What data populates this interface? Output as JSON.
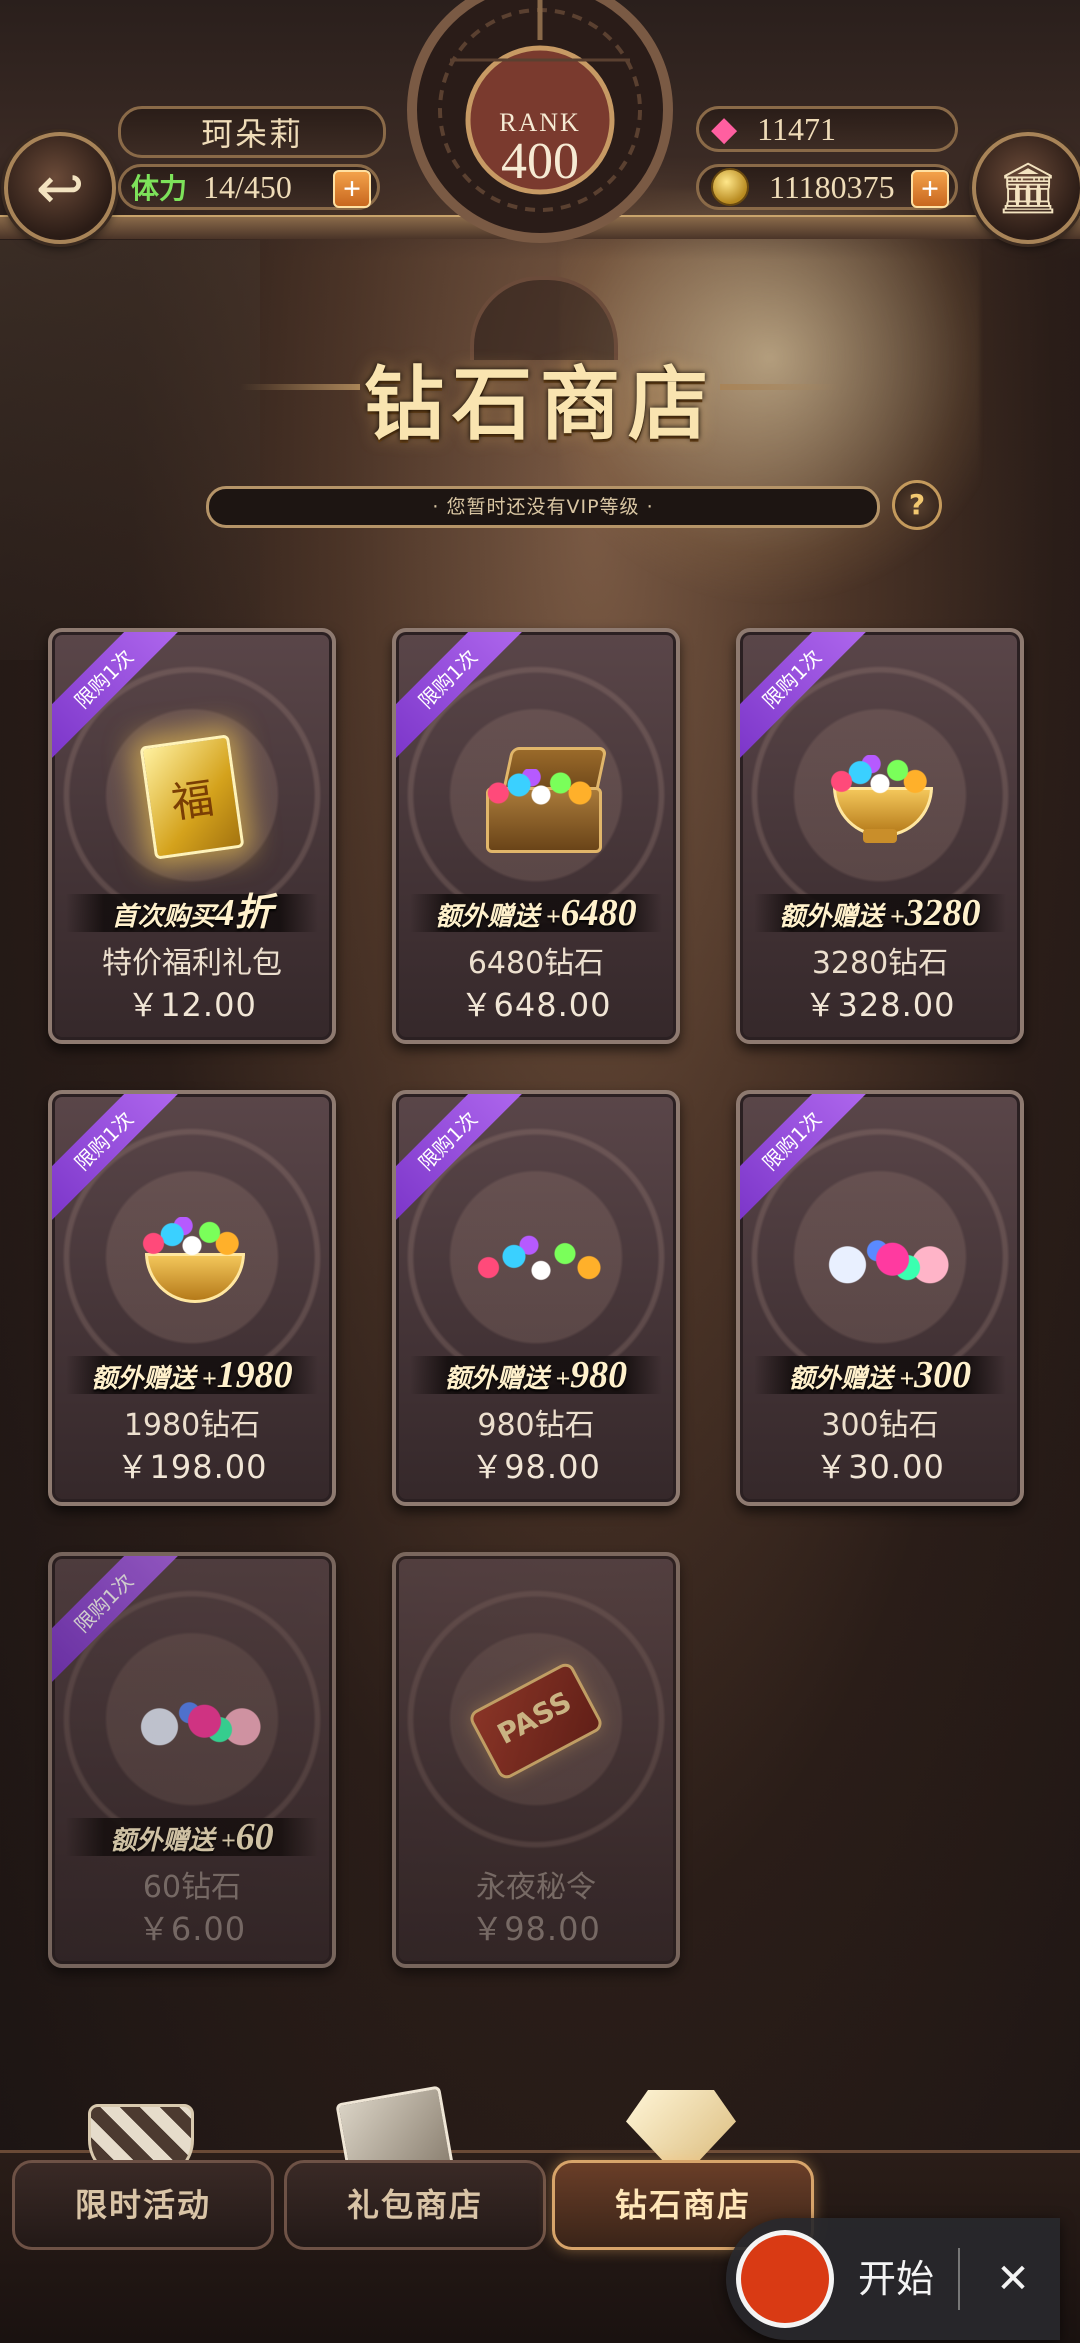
{
  "header": {
    "player_name": "珂朵莉",
    "stamina_label": "体力",
    "stamina_value": "14/450",
    "rank_label": "RANK",
    "rank_value": "400",
    "diamonds": "11471",
    "gold": "11180375",
    "plus_symbol": "+"
  },
  "shop": {
    "title": "钻石商店",
    "vip_notice": "· 您暂时还没有VIP等级 ·",
    "help_symbol": "?"
  },
  "cards": [
    {
      "badge": "限购1次",
      "bonus_prefix": "首次购买",
      "bonus_value": "4折",
      "name": "特价福利礼包",
      "price": "￥12.00",
      "icon": "fu-card-icon",
      "dim": false
    },
    {
      "badge": "限购1次",
      "bonus_prefix": "额外赠送 +",
      "bonus_value": "6480",
      "name": "6480钻石",
      "price": "￥648.00",
      "icon": "treasure-chest-icon",
      "dim": false
    },
    {
      "badge": "限购1次",
      "bonus_prefix": "额外赠送 +",
      "bonus_value": "3280",
      "name": "3280钻石",
      "price": "￥328.00",
      "icon": "gem-bowl-icon",
      "dim": false
    },
    {
      "badge": "限购1次",
      "bonus_prefix": "额外赠送 +",
      "bonus_value": "1980",
      "name": "1980钻石",
      "price": "￥198.00",
      "icon": "gem-bowl-icon",
      "dim": false
    },
    {
      "badge": "限购1次",
      "bonus_prefix": "额外赠送 +",
      "bonus_value": "980",
      "name": "980钻石",
      "price": "￥98.00",
      "icon": "gem-pile-icon",
      "dim": false
    },
    {
      "badge": "限购1次",
      "bonus_prefix": "额外赠送 +",
      "bonus_value": "300",
      "name": "300钻石",
      "price": "￥30.00",
      "icon": "gem-small-pile-icon",
      "dim": false
    },
    {
      "badge": "限购1次",
      "bonus_prefix": "额外赠送 +",
      "bonus_value": "60",
      "name": "60钻石",
      "price": "￥6.00",
      "icon": "gem-small-pile-icon",
      "dim": true
    },
    {
      "badge": "",
      "bonus_prefix": "",
      "bonus_value": "",
      "name": "永夜秘令",
      "price": "￥98.00",
      "icon": "pass-ticket-icon",
      "pass_text": "PASS",
      "dim": true
    }
  ],
  "bottom_nav": {
    "tabs": [
      {
        "label": "限时活动",
        "icon": "magic-hat-icon",
        "active": false
      },
      {
        "label": "礼包商店",
        "icon": "gift-box-icon",
        "active": false
      },
      {
        "label": "钻石商店",
        "icon": "diamond-icon",
        "active": true
      }
    ]
  },
  "recorder": {
    "start_label": "开始",
    "close_symbol": "✕"
  },
  "colors": {
    "accent_gold": "#f9e4b0",
    "badge_purple": "#9a4ee0",
    "stamina_green": "#7de25a",
    "record_red": "#d93a14"
  }
}
